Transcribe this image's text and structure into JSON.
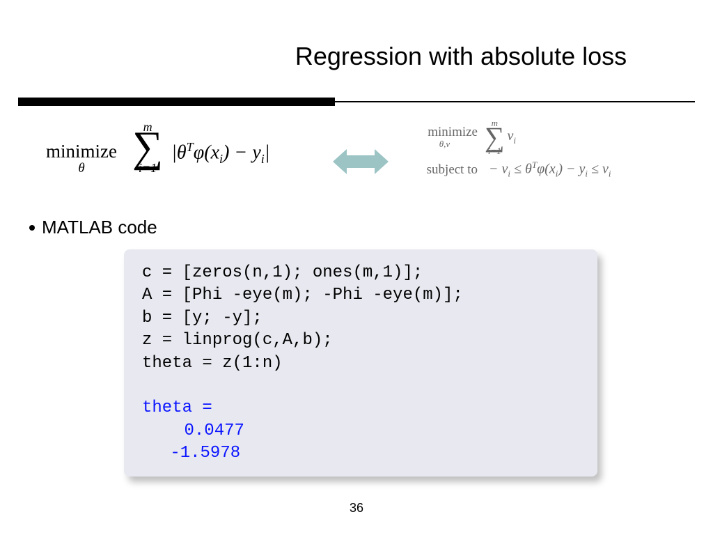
{
  "title": "Regression with absolute loss",
  "left_formula": {
    "minimize": "minimize",
    "minimize_sub": "θ",
    "sum_top": "m",
    "sum_bot": "i=1",
    "expr": "|θᵀφ(xᵢ) − yᵢ|"
  },
  "right_formula": {
    "minimize": "minimize",
    "minimize_sub": "θ,ν",
    "sum_top": "m",
    "sum_bot": "i=1",
    "sum_expr": "νᵢ",
    "subject_to": "subject to",
    "constraint": "− νᵢ ≤ θᵀφ(xᵢ) − yᵢ ≤ νᵢ"
  },
  "bullet": "MATLAB code",
  "code": {
    "l1": "c = [zeros(n,1); ones(m,1)];",
    "l2": "A = [Phi -eye(m); -Phi -eye(m)];",
    "l3": "b = [y; -y];",
    "l4": "z = linprog(c,A,b);",
    "l5": "theta = z(1:n)",
    "out_label": "theta =",
    "out_v1": "0.0477",
    "out_v2": "-1.5978"
  },
  "page_number": "36",
  "colors": {
    "arrow": "#9cc4c5",
    "code_bg": "#e8e9f0",
    "output": "#0a14ff"
  }
}
